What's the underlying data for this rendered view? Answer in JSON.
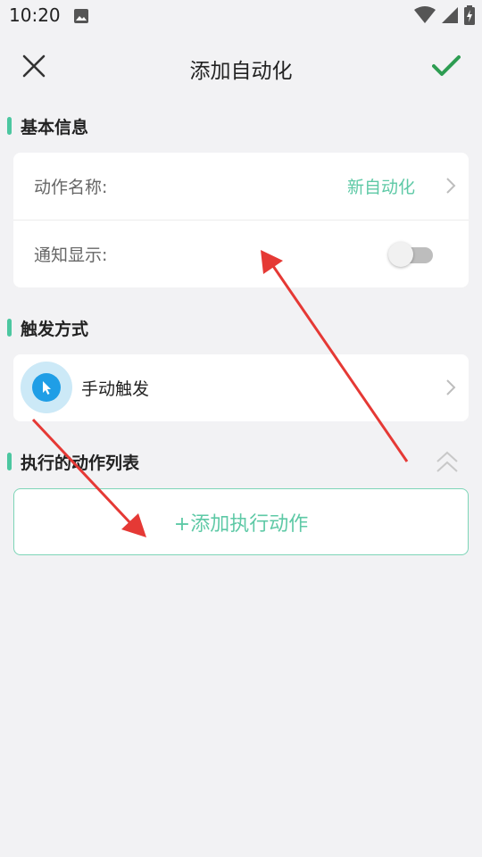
{
  "status": {
    "time": "10:20",
    "icons": [
      "image-icon",
      "wifi-icon",
      "signal-icon",
      "battery-icon"
    ]
  },
  "header": {
    "title": "添加自动化",
    "close_icon": "close-icon",
    "confirm_icon": "check-icon"
  },
  "sections": {
    "basic": {
      "title": "基本信息",
      "action_name_label": "动作名称:",
      "action_name_value": "新自动化",
      "notify_label": "通知显示:",
      "notify_enabled": false
    },
    "trigger": {
      "title": "触发方式",
      "label": "手动触发",
      "icon": "cursor-icon"
    },
    "actions": {
      "title": "执行的动作列表",
      "add_label": "+添加执行动作",
      "collapse_icon": "double-chevron-up-icon"
    }
  },
  "colors": {
    "accent": "#5ec9a6",
    "confirm": "#2e9d52",
    "trigger_icon": "#1f9ee6",
    "annotation_arrow": "#e53935",
    "background": "#f2f2f4"
  }
}
